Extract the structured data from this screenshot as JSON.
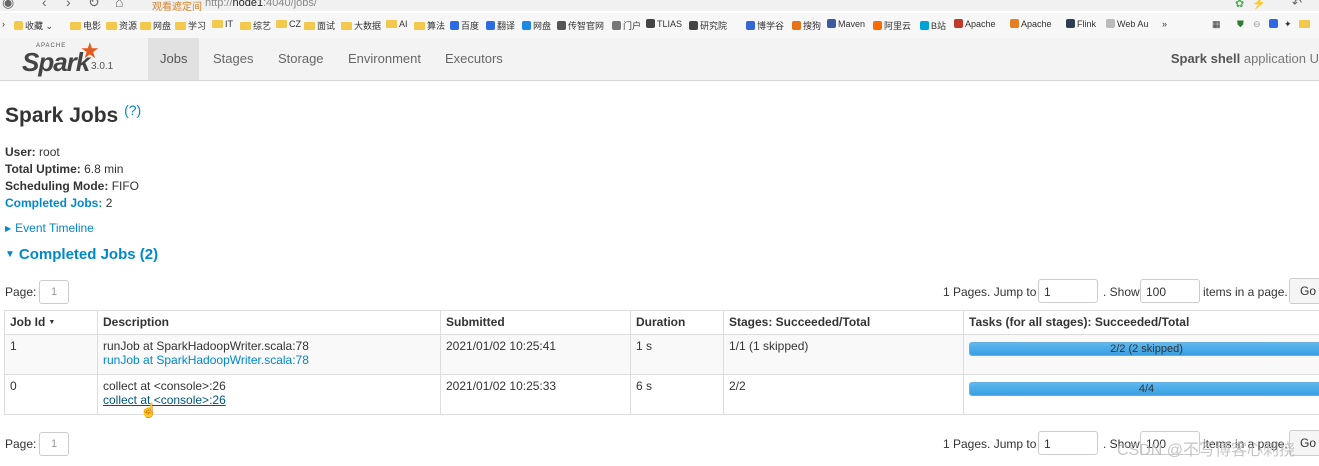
{
  "browser": {
    "warning_text": "观看遮定间",
    "url_prefix": "http://",
    "url_host": "node1",
    "url_rest": ":4040/jobs/",
    "bookmarks": [
      "收藏",
      "电影",
      "资源",
      "网盘",
      "学习",
      "IT",
      "综艺",
      "CZ",
      "面试",
      "大数据",
      "AI",
      "算法",
      "百度",
      "翻译",
      "网盘",
      "传智官网",
      "门户",
      "TLIAS",
      "研究院",
      "博学谷",
      "搜狗",
      "Maven",
      "阿里云",
      "B站",
      "Apache",
      "Apache",
      "Flink",
      "Web Au",
      "»"
    ]
  },
  "navbar": {
    "logo_apache": "APACHE",
    "logo_word": "Spark",
    "version": "3.0.1",
    "tabs": [
      "Jobs",
      "Stages",
      "Storage",
      "Environment",
      "Executors"
    ],
    "app_name": "Spark shell",
    "app_suffix": "application U"
  },
  "page": {
    "title": "Spark Jobs",
    "help": "(?)",
    "user_label": "User:",
    "user_value": "root",
    "uptime_label": "Total Uptime:",
    "uptime_value": "6.8 min",
    "mode_label": "Scheduling Mode:",
    "mode_value": "FIFO",
    "completed_label": "Completed Jobs:",
    "completed_value": "2",
    "event_timeline": "Event Timeline",
    "section_title": "Completed Jobs (2)"
  },
  "pager": {
    "page_label": "Page:",
    "page_value": "1",
    "pages_text": "1 Pages. Jump to",
    "jump_value": "1",
    "show_text": ". Show",
    "show_value": "100",
    "items_text": "items in a page.",
    "go_label": "Go"
  },
  "table": {
    "headers": [
      "Job Id",
      "Description",
      "Submitted",
      "Duration",
      "Stages: Succeeded/Total",
      "Tasks (for all stages): Succeeded/Total"
    ],
    "rows": [
      {
        "id": "1",
        "desc": "runJob at SparkHadoopWriter.scala:78",
        "desc_link": "runJob at SparkHadoopWriter.scala:78",
        "submitted": "2021/01/02 10:25:41",
        "duration": "1 s",
        "stages": "1/1 (1 skipped)",
        "tasks_text": "2/2 (2 skipped)",
        "tasks_fraction": 1.0
      },
      {
        "id": "0",
        "desc": "collect at <console>:26",
        "desc_link": "collect at <console>:26",
        "submitted": "2021/01/02 10:25:33",
        "duration": "6 s",
        "stages": "2/2",
        "tasks_text": "4/4",
        "tasks_fraction": 1.0
      }
    ]
  },
  "watermark": "CSDN @不写博客心刺挠"
}
